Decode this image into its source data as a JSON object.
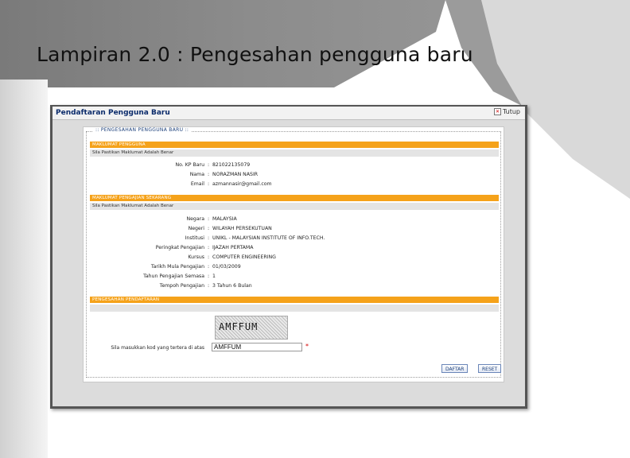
{
  "slide": {
    "title": "Lampiran 2.0 : Pengesahan pengguna baru"
  },
  "window": {
    "title": "Pendaftaran Pengguna Baru",
    "close_label": "Tutup"
  },
  "form": {
    "legend": ":: PENGESAHAN PENGGUNA BARU ::",
    "section_user": {
      "title": "MAKLUMAT PENGGUNA",
      "subtitle": "Sila Pastikan Maklumat Adalah Benar",
      "rows": [
        {
          "label": "No. KP Baru",
          "value": "821022135079"
        },
        {
          "label": "Nama",
          "value": "NORAZMAN NASIR"
        },
        {
          "label": "Email",
          "value": "azmannasir@gmail.com"
        }
      ]
    },
    "section_study": {
      "title": "MAKLUMAT PENGAJIAN SEKARANG",
      "subtitle": "Sila Pastikan Maklumat Adalah Benar",
      "rows": [
        {
          "label": "Negara",
          "value": "MALAYSIA"
        },
        {
          "label": "Negeri",
          "value": "WILAYAH PERSEKUTUAN"
        },
        {
          "label": "Institusi",
          "value": "UNIKL - MALAYSIAN INSTITUTE OF INFO.TECH."
        },
        {
          "label": "Peringkat Pengajian",
          "value": "IJAZAH PERTAMA"
        },
        {
          "label": "Kursus",
          "value": "COMPUTER ENGINEERING"
        },
        {
          "label": "Tarikh Mula Pengajian",
          "value": "01/03/2009"
        },
        {
          "label": "Tahun Pengajian Semasa",
          "value": "1"
        },
        {
          "label": "Tempoh Pengajian",
          "value": "3 Tahun 6 Bulan"
        }
      ]
    },
    "section_confirm": {
      "title": "PENGESAHAN PENDAFTARAN"
    },
    "captcha": {
      "image_text": "AMFFUM",
      "label": "Sila masukkan kod yang tertera di atas",
      "value": "AMFFUM",
      "required_mark": "*"
    },
    "buttons": {
      "submit": "DAFTAR",
      "reset": "RESET"
    },
    "separator": ":"
  }
}
